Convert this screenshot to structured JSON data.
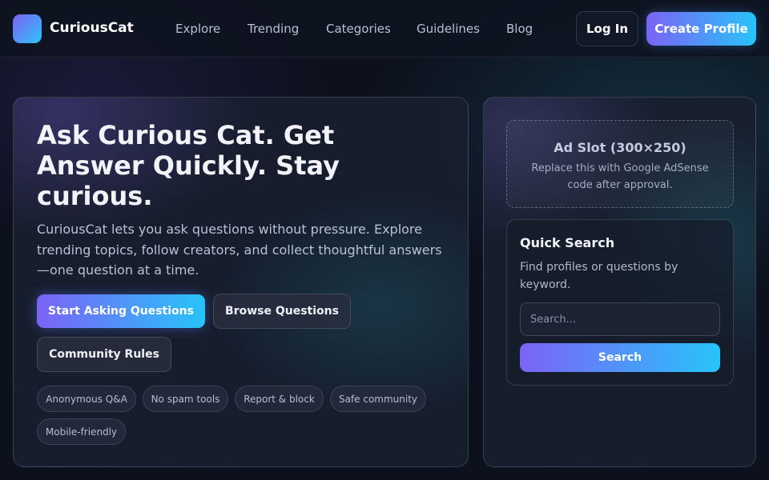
{
  "header": {
    "brand": "CuriousCat",
    "nav": [
      "Explore",
      "Trending",
      "Categories",
      "Guidelines",
      "Blog"
    ],
    "login_label": "Log In",
    "create_label": "Create Profile"
  },
  "hero": {
    "title": "Ask Curious Cat. Get Answer Quickly. Stay curious.",
    "description": "CuriousCat lets you ask questions without pressure. Explore trending topics, follow creators, and collect thoughtful answers—one question at a time.",
    "primary_cta": "Start Asking Questions",
    "browse_label": "Browse Questions",
    "rules_label": "Community Rules",
    "chips": [
      "Anonymous Q&A",
      "No spam tools",
      "Report & block",
      "Safe community",
      "Mobile-friendly"
    ]
  },
  "sidebar": {
    "ad_title": "Ad Slot (300×250)",
    "ad_desc": "Replace this with Google AdSense code after approval.",
    "search_title": "Quick Search",
    "search_desc": "Find profiles or questions by keyword.",
    "search_placeholder": "Search...",
    "search_button": "Search"
  },
  "colors": {
    "accent_start": "#7b63f6",
    "accent_end": "#27c4fb",
    "background": "#0c111d"
  }
}
